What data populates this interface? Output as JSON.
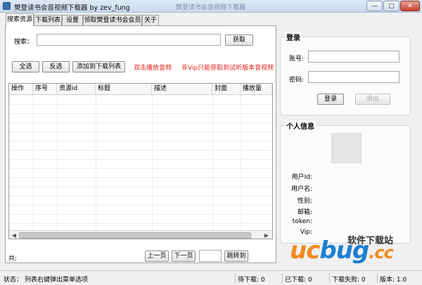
{
  "window": {
    "title": "樊登读书会音视频下载器 by zev_fung",
    "ghost_title": "樊登读书会音视频下载器",
    "minimize": "—",
    "maximize": "□",
    "close": "✕"
  },
  "tabs": [
    {
      "label": "搜索资源"
    },
    {
      "label": "下载列表"
    },
    {
      "label": "设置"
    },
    {
      "label": "领取樊登读书会会员"
    },
    {
      "label": "关于"
    }
  ],
  "search": {
    "label": "搜索：",
    "value": "",
    "button": "获取"
  },
  "toolbar": {
    "select_all": "全选",
    "invert": "反选",
    "add_download": "添加到下载列表",
    "hint_dblclick": "双击播放音频",
    "hint_vip": "非Vip只能获取到试听版本音视频"
  },
  "table": {
    "columns": [
      "操作",
      "序号",
      "资源id",
      "标题",
      "描述",
      "封面",
      "播放量"
    ],
    "rows": []
  },
  "pager": {
    "total_label": "共:",
    "prev": "上一页",
    "next": "下一页",
    "page_value": "",
    "goto": "跳转到"
  },
  "login": {
    "title": "登录",
    "account_label": "账号:",
    "account_value": "",
    "password_label": "密码:",
    "password_value": "",
    "login_button": "登录",
    "logout_button": "退出"
  },
  "profile": {
    "title": "个人信息",
    "fields": [
      {
        "label": "用户Id:",
        "value": ""
      },
      {
        "label": "用户名:",
        "value": ""
      },
      {
        "label": "性别:",
        "value": ""
      },
      {
        "label": "邮箱:",
        "value": ""
      },
      {
        "label": "token:",
        "value": ""
      },
      {
        "label": "Vip:",
        "value": ""
      }
    ]
  },
  "status": {
    "state_label": "状态：",
    "state_value": "列表右键弹出菜单选项",
    "pending": "待下载: 0",
    "downloaded": "已下载: 0",
    "failed": "下载失败: 0",
    "version": "版本: 1.0"
  },
  "watermark": {
    "text_cn": "软件下载站",
    "logo_orange": "uc",
    "logo_blue": "bug",
    "logo_tail": ".cc"
  },
  "colors": {
    "hint_red": "#e0221a",
    "logo_orange": "#f08a1c",
    "logo_blue": "#1e7fd0"
  }
}
